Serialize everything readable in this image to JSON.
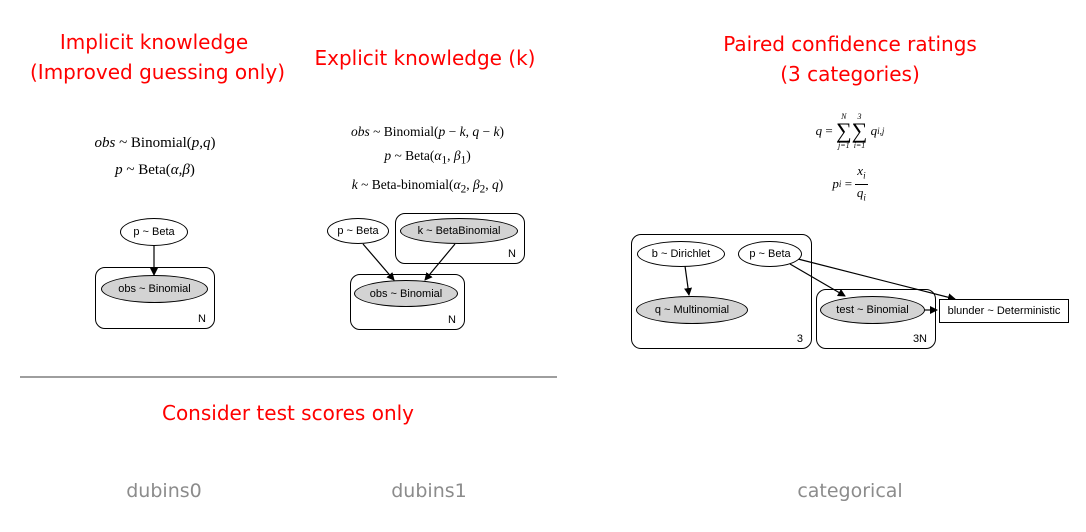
{
  "headings": {
    "implicit_line1": "Implicit knowledge",
    "implicit_line2": "(Improved guessing only)",
    "explicit": "Explicit knowledge (k)",
    "paired_line1": "Paired confidence ratings",
    "paired_line2": "(3 categories)",
    "consider": "Consider test scores only"
  },
  "footer": {
    "model1": "dubins0",
    "model2": "dubins1",
    "model3": "categorical"
  },
  "dubins0": {
    "node_p": "p ~ Beta",
    "node_obs": "obs ~ Binomial",
    "plate": "N"
  },
  "dubins1": {
    "node_p": "p ~ Beta",
    "node_k": "k ~ BetaBinomial",
    "node_obs": "obs ~ Binomial",
    "plate_k": "N",
    "plate_obs": "N"
  },
  "categorical": {
    "node_b": "b ~ Dirichlet",
    "node_p": "p ~ Beta",
    "node_q": "q ~ Multinomial",
    "node_test": "test ~ Binomial",
    "node_blunder": "blunder ~ Deterministic",
    "plate_q": "3",
    "plate_test": "3N"
  },
  "colors": {
    "heading": "#ff0000",
    "footer": "#8c8c8c",
    "observed_node": "#d3d3d3",
    "divider": "#7f7f7f"
  }
}
